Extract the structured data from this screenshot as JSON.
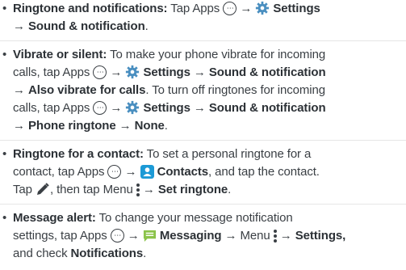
{
  "items": [
    {
      "title": "Ringtone and notifications:",
      "t1": " Tap Apps ",
      "arrow": "→",
      "settings": "Settings",
      "sound": "Sound & notification",
      "end": "."
    },
    {
      "title": "Vibrate or silent:",
      "t1": " To make your phone vibrate for incoming",
      "t2": "calls, tap Apps ",
      "settings": "Settings",
      "sound": "Sound & notification",
      "also": "Also vibrate for calls",
      "t3": ". To turn off ringtones for incoming",
      "t4": "calls, tap Apps ",
      "phone": "Phone ringtone",
      "none": "None",
      "end": "."
    },
    {
      "title": "Ringtone for a contact:",
      "t1": " To set a personal ringtone for a",
      "t2": "contact, tap Apps ",
      "contacts": "Contacts",
      "t3": ", and tap the contact.",
      "t4": "Tap ",
      "t5": ", then tap Menu ",
      "set": "Set ringtone",
      "end": "."
    },
    {
      "title": "Message alert:",
      "t1": " To change your message notification",
      "t2": "settings, tap Apps ",
      "messaging": "Messaging",
      "t3": " → Menu ",
      "settings2": "Settings,",
      "t4": "and check ",
      "notif": "Notifications",
      "end": "."
    }
  ],
  "colors": {
    "text": "#3a3f44",
    "gear": "#4a8fc0",
    "contacts": "#1c9ad6",
    "messaging": "#8bc34a"
  }
}
